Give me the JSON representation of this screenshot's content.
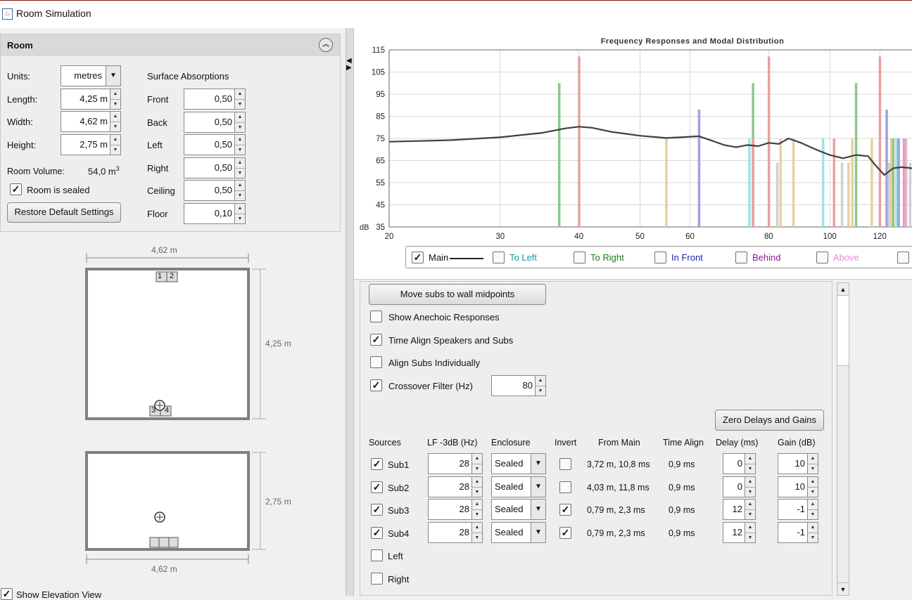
{
  "window": {
    "title": "Room Simulation",
    "icon": "java-icon"
  },
  "room": {
    "header": "Room",
    "units_label": "Units:",
    "units_value": "metres",
    "length_label": "Length:",
    "length_value": "4,25 m",
    "width_label": "Width:",
    "width_value": "4,62 m",
    "height_label": "Height:",
    "height_value": "2,75 m",
    "volume_label": "Room Volume:",
    "volume_value": "54,0 m",
    "volume_sup": "3",
    "sealed_label": "Room is sealed",
    "sealed_checked": true,
    "restore_button": "Restore Default Settings",
    "surface_title": "Surface Absorptions",
    "surfaces": [
      {
        "label": "Front",
        "value": "0,50"
      },
      {
        "label": "Back",
        "value": "0,50"
      },
      {
        "label": "Left",
        "value": "0,50"
      },
      {
        "label": "Right",
        "value": "0,50"
      },
      {
        "label": "Ceiling",
        "value": "0,50"
      },
      {
        "label": "Floor",
        "value": "0,10"
      }
    ]
  },
  "plan": {
    "top_width_label": "4,62 m",
    "length_label": "4,25 m",
    "height_label": "2,75 m",
    "bottom_width_label": "4,62 m",
    "sub_labels_top": [
      "1",
      "2"
    ],
    "sub_labels_bottom": [
      "3",
      "4"
    ],
    "show_elevation_label": "Show Elevation View",
    "show_elevation_checked": true
  },
  "chart_data": {
    "type": "line",
    "title": "Frequency Responses and Modal Distribution",
    "ylabel": "dB",
    "xscale": "log",
    "xlim": [
      20,
      135
    ],
    "ylim": [
      35,
      115
    ],
    "x_ticks": [
      20,
      30,
      40,
      50,
      60,
      80,
      100,
      120
    ],
    "y_ticks": [
      35,
      45,
      55,
      65,
      75,
      85,
      95,
      105,
      115
    ],
    "grid": true,
    "series": [
      {
        "name": "Main",
        "color": "#404040",
        "x": [
          20,
          25,
          30,
          35,
          38,
          40,
          42,
          45,
          50,
          55,
          58,
          62,
          65,
          68,
          71,
          74,
          77,
          80,
          83,
          86,
          90,
          95,
          100,
          105,
          110,
          115,
          118,
          122,
          126,
          130,
          135
        ],
        "y": [
          73.5,
          74.2,
          75.5,
          77.5,
          79.5,
          80.3,
          79.8,
          78.0,
          76.2,
          75.2,
          75.5,
          76.0,
          74.0,
          72.0,
          71.0,
          72.0,
          71.5,
          73.0,
          72.5,
          75.0,
          73.0,
          70.0,
          67.5,
          66.0,
          67.5,
          67.0,
          63.0,
          58.5,
          61.5,
          62.0,
          61.5
        ]
      }
    ],
    "modes": [
      {
        "x": 37.2,
        "y": 100,
        "color": "#8cc98c"
      },
      {
        "x": 40.0,
        "y": 112,
        "color": "#e8a0a0"
      },
      {
        "x": 55.0,
        "y": 75,
        "color": "#e8d0a0"
      },
      {
        "x": 62.0,
        "y": 88,
        "color": "#a0a0e0"
      },
      {
        "x": 74.5,
        "y": 75,
        "color": "#9fe3e3"
      },
      {
        "x": 75.5,
        "y": 100,
        "color": "#8cc98c"
      },
      {
        "x": 75.5,
        "y": 75,
        "color": "#e8a0a0"
      },
      {
        "x": 80.0,
        "y": 112,
        "color": "#e8a0a0"
      },
      {
        "x": 82.5,
        "y": 64,
        "color": "#d0d0d0"
      },
      {
        "x": 83.5,
        "y": 75,
        "color": "#e8d0a0"
      },
      {
        "x": 87.5,
        "y": 75,
        "color": "#e8d0a0"
      },
      {
        "x": 97.5,
        "y": 75,
        "color": "#9fe3e3"
      },
      {
        "x": 101.5,
        "y": 75,
        "color": "#e8a0a0"
      },
      {
        "x": 104.5,
        "y": 64,
        "color": "#d0d0d0"
      },
      {
        "x": 107.0,
        "y": 64,
        "color": "#e8d0a0"
      },
      {
        "x": 108.5,
        "y": 75,
        "color": "#e8d0a0"
      },
      {
        "x": 110.0,
        "y": 100,
        "color": "#8cc98c"
      },
      {
        "x": 116.5,
        "y": 75,
        "color": "#e8d0a0"
      },
      {
        "x": 120.0,
        "y": 112,
        "color": "#e8a0a0"
      },
      {
        "x": 123.0,
        "y": 88,
        "color": "#a0a0e0"
      },
      {
        "x": 124.0,
        "y": 64,
        "color": "#d0d0d0"
      },
      {
        "x": 125.0,
        "y": 75,
        "color": "#e8d0a0"
      },
      {
        "x": 126.0,
        "y": 75,
        "color": "#8cc98c"
      },
      {
        "x": 127.5,
        "y": 75,
        "color": "#9fe3e3"
      },
      {
        "x": 128.5,
        "y": 75,
        "color": "#a0a0e0"
      },
      {
        "x": 131.0,
        "y": 75,
        "color": "#e8a0a0"
      },
      {
        "x": 132.0,
        "y": 75,
        "color": "#e0b0e0"
      },
      {
        "x": 134.0,
        "y": 64,
        "color": "#d0d0d0"
      }
    ]
  },
  "legend": {
    "items": [
      {
        "label": "Main",
        "checked": true,
        "color": "#111111"
      },
      {
        "label": "To Left",
        "checked": false,
        "color": "#1a9a9a"
      },
      {
        "label": "To Right",
        "checked": false,
        "color": "#1a7a1a"
      },
      {
        "label": "In Front",
        "checked": false,
        "color": "#2020b0"
      },
      {
        "label": "Behind",
        "checked": false,
        "color": "#8a1a8a"
      },
      {
        "label": "Above",
        "checked": false,
        "color": "#e08ae0"
      },
      {
        "label": "",
        "checked": false,
        "color": "#111111"
      }
    ]
  },
  "controls": {
    "move_subs_button": "Move subs to wall midpoints",
    "options": [
      {
        "label": "Show Anechoic Responses",
        "checked": false
      },
      {
        "label": "Time Align Speakers and Subs",
        "checked": true
      },
      {
        "label": "Align Subs Individually",
        "checked": false
      },
      {
        "label": "Crossover Filter (Hz)",
        "checked": true
      }
    ],
    "crossover_value": "80",
    "zero_button": "Zero Delays and Gains",
    "columns": [
      "Sources",
      "LF -3dB (Hz)",
      "Enclosure",
      "Invert",
      "From Main",
      "Time Align",
      "Delay (ms)",
      "Gain (dB)"
    ],
    "rows": [
      {
        "name": "Sub1",
        "checked": true,
        "lf": "28",
        "enclosure": "Sealed",
        "invert": false,
        "from_main": "3,72 m, 10,8 ms",
        "time_align": "0,9 ms",
        "delay": "0",
        "gain": "10"
      },
      {
        "name": "Sub2",
        "checked": true,
        "lf": "28",
        "enclosure": "Sealed",
        "invert": false,
        "from_main": "4,03 m, 11,8 ms",
        "time_align": "0,9 ms",
        "delay": "0",
        "gain": "10"
      },
      {
        "name": "Sub3",
        "checked": true,
        "lf": "28",
        "enclosure": "Sealed",
        "invert": true,
        "from_main": "0,79 m, 2,3 ms",
        "time_align": "0,9 ms",
        "delay": "12",
        "gain": "-1"
      },
      {
        "name": "Sub4",
        "checked": true,
        "lf": "28",
        "enclosure": "Sealed",
        "invert": true,
        "from_main": "0,79 m, 2,3 ms",
        "time_align": "0,9 ms",
        "delay": "12",
        "gain": "-1"
      }
    ],
    "extra_sources": [
      {
        "label": "Left",
        "checked": false
      },
      {
        "label": "Right",
        "checked": false
      }
    ]
  }
}
